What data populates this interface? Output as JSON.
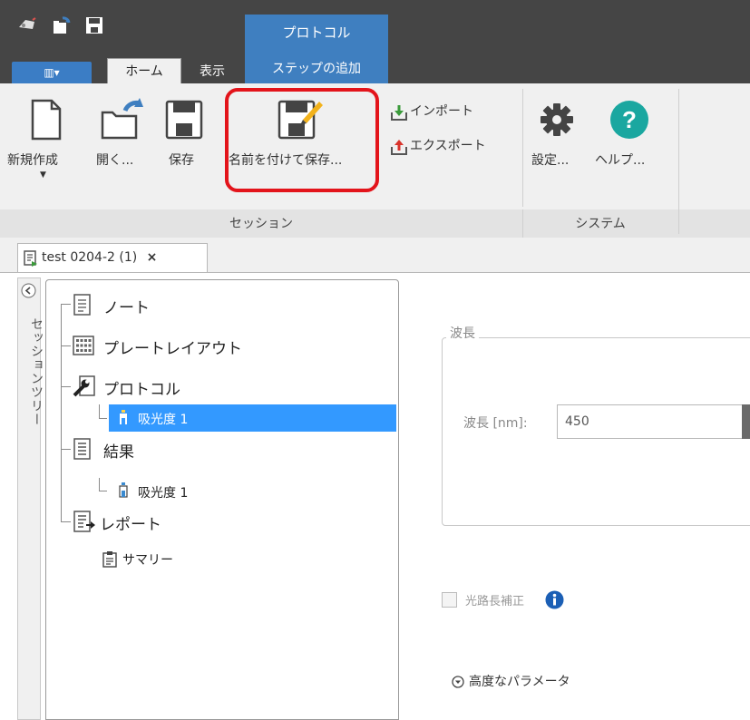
{
  "titlebar": {
    "context_group_title": "プロトコル"
  },
  "tabs": {
    "app_menu": "▥▾",
    "home": "ホーム",
    "view": "表示",
    "add_step": "ステップの追加"
  },
  "ribbon": {
    "new": "新規作成",
    "open": "開く...",
    "save": "保存",
    "save_as": "名前を付けて保存...",
    "import": "インポート",
    "export": "エクスポート",
    "settings": "設定...",
    "help": "ヘルプ...",
    "group_session": "セッション",
    "group_system": "システム"
  },
  "document": {
    "tab_title": "test 0204-2 (1)",
    "tab_close": "×"
  },
  "sidebar": {
    "collapse_glyph": "<",
    "label": "セッションツリー"
  },
  "tree": {
    "note": "ノート",
    "plate_layout": "プレートレイアウト",
    "protocol": "プロトコル",
    "protocol_absorbance": "吸光度 1",
    "results": "結果",
    "results_absorbance": "吸光度 1",
    "report": "レポート",
    "summary": "サマリー"
  },
  "wavelength": {
    "group_title": "波長",
    "field_label": "波長 [nm]:",
    "value": "450"
  },
  "pathlength": {
    "label": "光路長補正",
    "checked": false
  },
  "advanced": {
    "label": "高度なパラメータ"
  },
  "colors": {
    "titlebar": "#454545",
    "accent_blue": "#3f7fc0",
    "selection": "#3399ff",
    "highlight_red": "#e3141b",
    "help_teal": "#1aa7a0",
    "info_blue": "#1b5fb5"
  }
}
